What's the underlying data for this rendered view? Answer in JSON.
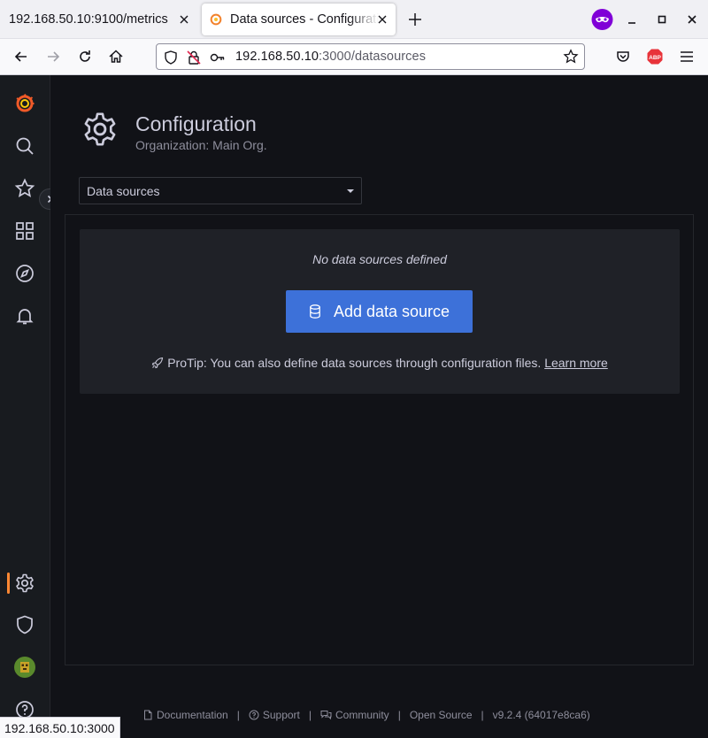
{
  "browser": {
    "tabs": [
      {
        "title": "192.168.50.10:9100/metrics"
      },
      {
        "title": "Data sources - Configuration - Grafana"
      }
    ],
    "url": {
      "host": "192.168.50.10",
      "path": ":3000/datasources"
    },
    "status_url": "192.168.50.10:3000"
  },
  "sidebar": {
    "items": [
      {
        "name": "grafana-logo"
      },
      {
        "name": "search-icon"
      },
      {
        "name": "starred-icon"
      },
      {
        "name": "dashboards-icon"
      },
      {
        "name": "explore-icon"
      },
      {
        "name": "alerting-icon"
      },
      {
        "name": "configuration-icon",
        "active": true
      },
      {
        "name": "server-admin-icon"
      },
      {
        "name": "profile-avatar"
      },
      {
        "name": "help-icon"
      }
    ]
  },
  "page": {
    "title": "Configuration",
    "subtitle": "Organization: Main Org.",
    "select_value": "Data sources"
  },
  "empty_state": {
    "message": "No data sources defined",
    "button_label": "Add data source",
    "protip": "ProTip: You can also define data sources through configuration files.",
    "learn_more": "Learn more"
  },
  "footer": {
    "documentation": "Documentation",
    "support": "Support",
    "community": "Community",
    "open_source": "Open Source",
    "version": "v9.2.4 (64017e8ca6)",
    "separator": "|"
  },
  "colors": {
    "primary_button": "#3d71d9",
    "active_accent": "#ff8833",
    "background": "#111217",
    "sidebar": "#181b1f"
  }
}
